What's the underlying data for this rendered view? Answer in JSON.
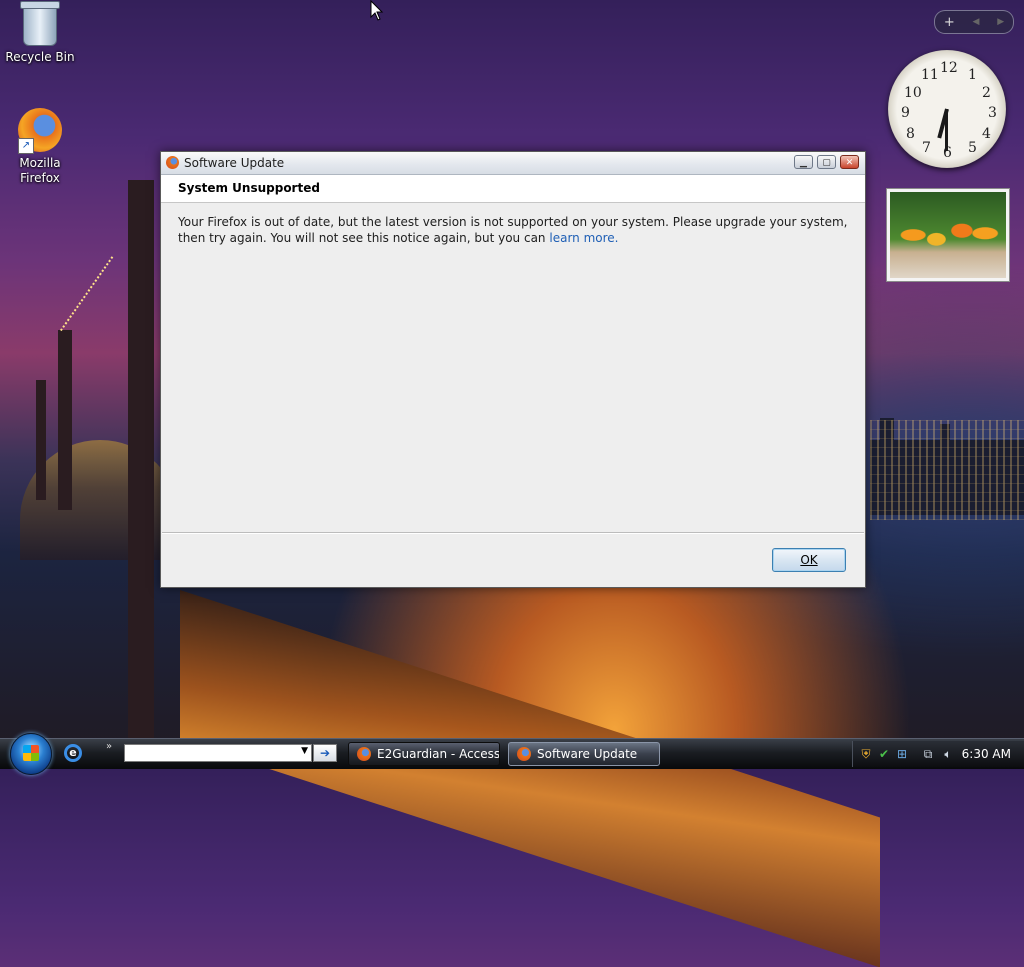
{
  "desktop": {
    "icons": [
      {
        "label": "Recycle Bin"
      },
      {
        "label": "Mozilla Firefox"
      }
    ]
  },
  "gadgets": {
    "controls": {
      "add": "+",
      "prev": "◀",
      "next": "▶"
    },
    "clock": {
      "numerals": [
        "12",
        "1",
        "2",
        "3",
        "4",
        "5",
        "6",
        "7",
        "8",
        "9",
        "10",
        "11"
      ],
      "hour": 6,
      "minute": 30
    }
  },
  "dialog": {
    "window_title": "Software Update",
    "header": "System Unsupported",
    "message": "Your Firefox is out of date, but the latest version is not supported on your system. Please upgrade your system, then try again. You will not see this notice again, but you can",
    "link": "learn more.",
    "ok_label": "OK"
  },
  "taskbar": {
    "address_value": "",
    "tasks": [
      {
        "label": "E2Guardian - Access..."
      },
      {
        "label": "Software Update",
        "active": true
      }
    ],
    "time": "6:30 AM"
  }
}
